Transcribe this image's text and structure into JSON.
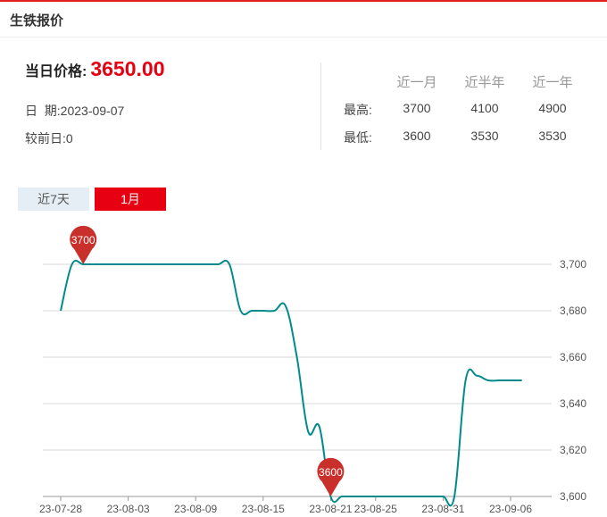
{
  "panel": {
    "title": "生铁报价"
  },
  "price": {
    "label": "当日价格:",
    "value": "3650.00",
    "date_label": "日  期:",
    "date": "2023-09-07",
    "change_label": "较前日:",
    "change": "0"
  },
  "stats": {
    "headers": [
      "近一月",
      "近半年",
      "近一年"
    ],
    "rows": [
      {
        "label": "最高:",
        "values": [
          "3700",
          "4100",
          "4900"
        ]
      },
      {
        "label": "最低:",
        "values": [
          "3600",
          "3530",
          "3530"
        ]
      }
    ]
  },
  "tabs": [
    {
      "label": "近7天",
      "active": false
    },
    {
      "label": "1月",
      "active": true
    }
  ],
  "colors": {
    "accent": "#e60012",
    "line": "#008b8b",
    "marker": "#c9302c",
    "grid": "#d9d9d9"
  },
  "chart_data": {
    "type": "line",
    "x_ticks": [
      "23-07-28",
      "23-08-03",
      "23-08-09",
      "23-08-15",
      "23-08-21",
      "23-08-25",
      "23-08-31",
      "23-09-06"
    ],
    "y_ticks": [
      "3,700",
      "3,680",
      "3,660",
      "3,640",
      "3,620",
      "3,600"
    ],
    "ylim": [
      3600,
      3700
    ],
    "y_tick_values": [
      3700,
      3680,
      3660,
      3640,
      3620,
      3600
    ],
    "dates": [
      "07-28",
      "07-29",
      "07-30",
      "07-31",
      "08-01",
      "08-02",
      "08-03",
      "08-04",
      "08-05",
      "08-06",
      "08-07",
      "08-08",
      "08-09",
      "08-10",
      "08-11",
      "08-12",
      "08-13",
      "08-14",
      "08-15",
      "08-16",
      "08-17",
      "08-18",
      "08-19",
      "08-20",
      "08-21",
      "08-22",
      "08-23",
      "08-24",
      "08-25",
      "08-26",
      "08-27",
      "08-28",
      "08-29",
      "08-30",
      "08-31",
      "09-01",
      "09-02",
      "09-03",
      "09-04",
      "09-05",
      "09-06",
      "09-07"
    ],
    "series": [
      {
        "values": [
          3680,
          3700,
          3700,
          3700,
          3700,
          3700,
          3700,
          3700,
          3700,
          3700,
          3700,
          3700,
          3700,
          3700,
          3700,
          3700,
          3680,
          3680,
          3680,
          3680,
          3682,
          3660,
          3628,
          3630,
          3600,
          3600,
          3600,
          3600,
          3600,
          3600,
          3600,
          3600,
          3600,
          3600,
          3600,
          3600,
          3650,
          3652,
          3650,
          3650,
          3650,
          3650
        ]
      }
    ],
    "markers": [
      {
        "label": "3700",
        "index": 2,
        "value": 3700
      },
      {
        "label": "3600",
        "index": 24,
        "value": 3600
      }
    ]
  }
}
